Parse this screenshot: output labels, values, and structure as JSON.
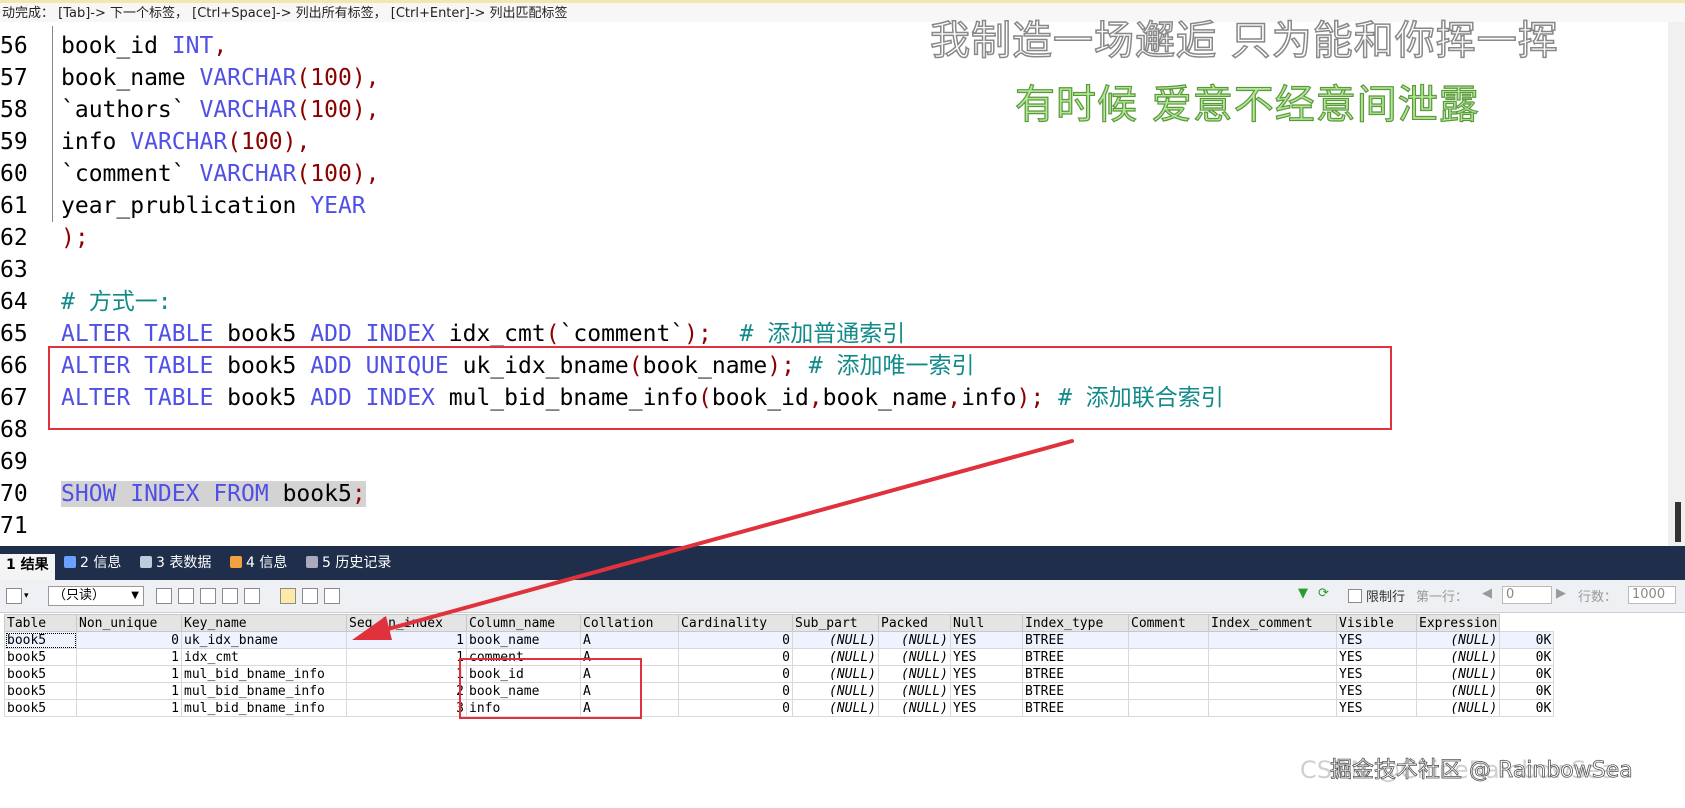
{
  "hint_bar": "动完成： [Tab]-> 下一个标签， [Ctrl+Space]-> 列出所有标签， [Ctrl+Enter]-> 列出匹配标签",
  "watermark": {
    "line1": "我制造一场邂逅 只为能和你挥一挥",
    "line2": "有时候 爱意不经意间泄露"
  },
  "footer_watermark": {
    "under": "CSDN @ChineRainbowSea",
    "over": "掘金技术社区 @ RainbowSea"
  },
  "code_lines": [
    {
      "n": "56",
      "tokens": [
        [
          "id",
          "book_id "
        ],
        [
          "tp",
          "INT"
        ],
        [
          "p",
          ","
        ]
      ]
    },
    {
      "n": "57",
      "tokens": [
        [
          "id",
          "book_name "
        ],
        [
          "tp",
          "VARCHAR"
        ],
        [
          "p",
          "("
        ],
        [
          "num",
          "100"
        ],
        [
          "p",
          "),"
        ]
      ]
    },
    {
      "n": "58",
      "tokens": [
        [
          "id",
          "`authors` "
        ],
        [
          "tp",
          "VARCHAR"
        ],
        [
          "p",
          "("
        ],
        [
          "num",
          "100"
        ],
        [
          "p",
          "),"
        ]
      ]
    },
    {
      "n": "59",
      "tokens": [
        [
          "id",
          "info "
        ],
        [
          "tp",
          "VARCHAR"
        ],
        [
          "p",
          "("
        ],
        [
          "num",
          "100"
        ],
        [
          "p",
          "),"
        ]
      ]
    },
    {
      "n": "60",
      "tokens": [
        [
          "id",
          "`comment` "
        ],
        [
          "tp",
          "VARCHAR"
        ],
        [
          "p",
          "("
        ],
        [
          "num",
          "100"
        ],
        [
          "p",
          "),"
        ]
      ]
    },
    {
      "n": "61",
      "tokens": [
        [
          "id",
          "year_prublication "
        ],
        [
          "tp",
          "YEAR"
        ]
      ]
    },
    {
      "n": "62",
      "tokens": [
        [
          "p",
          ");"
        ]
      ]
    },
    {
      "n": "63",
      "tokens": []
    },
    {
      "n": "64",
      "tokens": [
        [
          "cm",
          "# 方式一:"
        ]
      ]
    },
    {
      "n": "65",
      "tokens": [
        [
          "kw",
          "ALTER TABLE "
        ],
        [
          "id",
          "book5 "
        ],
        [
          "kw",
          "ADD INDEX "
        ],
        [
          "id",
          "idx_cmt"
        ],
        [
          "p",
          "("
        ],
        [
          "id",
          "`comment`"
        ],
        [
          "p",
          ");"
        ],
        [
          "cm",
          "  # 添加普通索引"
        ]
      ]
    },
    {
      "n": "66",
      "tokens": [
        [
          "kw",
          "ALTER TABLE "
        ],
        [
          "id",
          "book5 "
        ],
        [
          "kw",
          "ADD UNIQUE "
        ],
        [
          "id",
          "uk_idx_bname"
        ],
        [
          "p",
          "("
        ],
        [
          "id",
          "book_name"
        ],
        [
          "p",
          ");"
        ],
        [
          "cm",
          " # 添加唯一索引"
        ]
      ]
    },
    {
      "n": "67",
      "tokens": [
        [
          "kw",
          "ALTER TABLE "
        ],
        [
          "id",
          "book5 "
        ],
        [
          "kw",
          "ADD INDEX "
        ],
        [
          "id",
          "mul_bid_bname_info"
        ],
        [
          "p",
          "("
        ],
        [
          "id",
          "book_id"
        ],
        [
          "p",
          ","
        ],
        [
          "id",
          "book_name"
        ],
        [
          "p",
          ","
        ],
        [
          "id",
          "info"
        ],
        [
          "p",
          ");"
        ],
        [
          "cm",
          " # 添加联合索引"
        ]
      ]
    },
    {
      "n": "68",
      "tokens": []
    },
    {
      "n": "69",
      "tokens": []
    },
    {
      "n": "70",
      "tokens": [
        [
          "kw",
          "SHOW INDEX FROM "
        ],
        [
          "id",
          "book5"
        ],
        [
          "p",
          ";"
        ]
      ],
      "selected": true
    },
    {
      "n": "71",
      "tokens": []
    }
  ],
  "tabs": [
    {
      "label": "1 结果",
      "active": true
    },
    {
      "label": "2 信息",
      "active": false
    },
    {
      "label": "3 表数据",
      "active": false
    },
    {
      "label": "4 信息",
      "active": false
    },
    {
      "label": "5 历史记录",
      "active": false
    }
  ],
  "toolbar": {
    "mode": "（只读）",
    "limit_label": "限制行",
    "first_row_label": "第一行：",
    "first_row_value": "0",
    "rows_label": "行数：",
    "rows_value": "1000"
  },
  "grid": {
    "columns": [
      "Table",
      "Non_unique",
      "Key_name",
      "Seq_in_index",
      "Column_name",
      "Collation",
      "Cardinality",
      "Sub_part",
      "Packed",
      "Null",
      "Index_type",
      "Comment",
      "Index_comment",
      "Visible",
      "Expression"
    ],
    "rows": [
      [
        "book5",
        "0",
        "uk_idx_bname",
        "1",
        "book_name",
        "A",
        "0",
        "(NULL)",
        "(NULL)",
        "YES",
        "BTREE",
        "",
        "",
        "YES",
        "(NULL)",
        "0K"
      ],
      [
        "book5",
        "1",
        "idx_cmt",
        "1",
        "comment",
        "A",
        "0",
        "(NULL)",
        "(NULL)",
        "YES",
        "BTREE",
        "",
        "",
        "YES",
        "(NULL)",
        "0K"
      ],
      [
        "book5",
        "1",
        "mul_bid_bname_info",
        "1",
        "book_id",
        "A",
        "0",
        "(NULL)",
        "(NULL)",
        "YES",
        "BTREE",
        "",
        "",
        "YES",
        "(NULL)",
        "0K"
      ],
      [
        "book5",
        "1",
        "mul_bid_bname_info",
        "2",
        "book_name",
        "A",
        "0",
        "(NULL)",
        "(NULL)",
        "YES",
        "BTREE",
        "",
        "",
        "YES",
        "(NULL)",
        "0K"
      ],
      [
        "book5",
        "1",
        "mul_bid_bname_info",
        "3",
        "info",
        "A",
        "0",
        "(NULL)",
        "(NULL)",
        "YES",
        "BTREE",
        "",
        "",
        "YES",
        "(NULL)",
        "0K"
      ]
    ]
  },
  "colors": {
    "annotation_red": "#e0323c",
    "keyword_blue": "#5050e6",
    "comment_teal": "#138a8a",
    "tabbar_bg": "#1f2e4a"
  }
}
